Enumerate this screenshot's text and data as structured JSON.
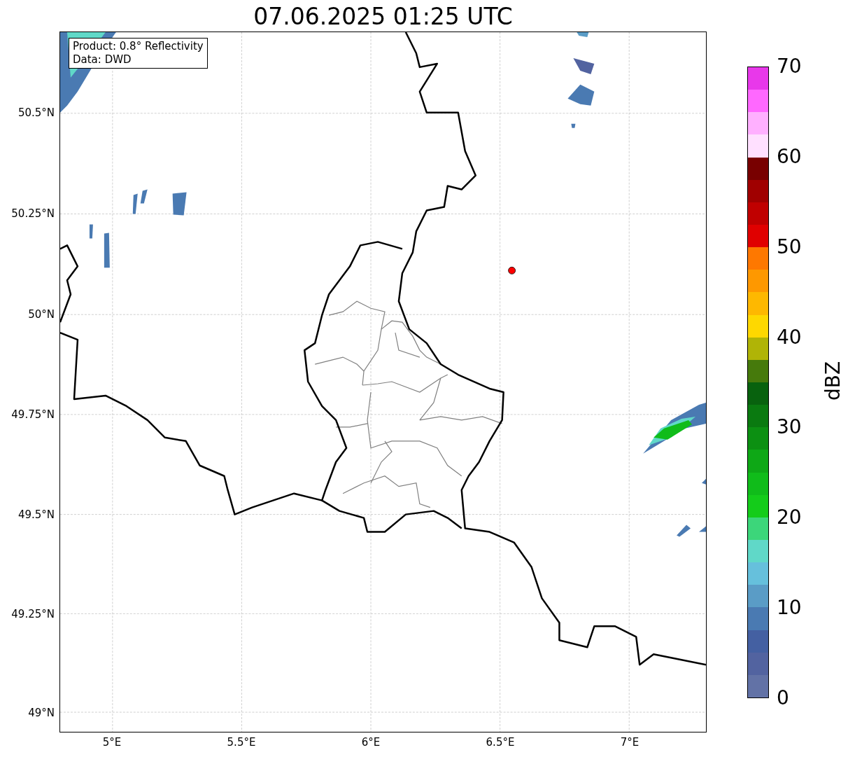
{
  "title": "07.06.2025 01:25 UTC",
  "legend": {
    "lines": [
      "Product: 0.8° Reflectivity",
      "Data: DWD"
    ]
  },
  "map": {
    "yticks": [
      "50.5°N",
      "50.25°N",
      "50°N",
      "49.75°N",
      "49.5°N",
      "49.25°N",
      "49°N"
    ],
    "xticks": [
      "5°E",
      "5.5°E",
      "6°E",
      "6.5°E",
      "7°E"
    ]
  },
  "colorbar": {
    "label": "dBZ",
    "ticks": [
      "70",
      "60",
      "50",
      "40",
      "30",
      "20",
      "10",
      "0"
    ],
    "segments": [
      {
        "color": "#e838ea"
      },
      {
        "color": "#ff68ff"
      },
      {
        "color": "#ffb0ff"
      },
      {
        "color": "#ffe0ff"
      },
      {
        "color": "#780000"
      },
      {
        "color": "#a00000"
      },
      {
        "color": "#c00000"
      },
      {
        "color": "#e00000"
      },
      {
        "color": "#fe7800"
      },
      {
        "color": "#fe9800"
      },
      {
        "color": "#feb800"
      },
      {
        "color": "#fed800"
      },
      {
        "color": "#b0b406"
      },
      {
        "color": "#467a0c"
      },
      {
        "color": "#08620e"
      },
      {
        "color": "#0a7a10"
      },
      {
        "color": "#0c9012"
      },
      {
        "color": "#0ea816"
      },
      {
        "color": "#10bc1a"
      },
      {
        "color": "#14cc1a"
      },
      {
        "color": "#3cd67a"
      },
      {
        "color": "#60d8c8"
      },
      {
        "color": "#66c0dc"
      },
      {
        "color": "#5a9cc6"
      },
      {
        "color": "#4a7ab2"
      },
      {
        "color": "#4460a2"
      },
      {
        "color": "#5263a0"
      },
      {
        "color": "#6272a6"
      }
    ]
  }
}
